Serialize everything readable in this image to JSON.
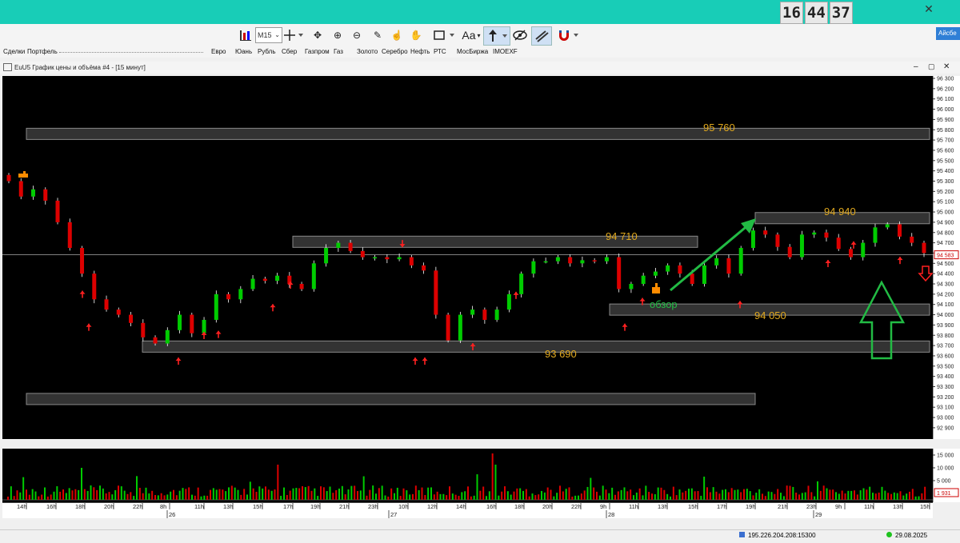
{
  "clock": {
    "h": "16",
    "m": "44",
    "s": "37"
  },
  "toolbar": {
    "timeframe": "M15",
    "text_tool": "Aa"
  },
  "tabs": [
    "Сделки",
    "Портфель"
  ],
  "instruments": [
    "Евро",
    "Юань",
    "Рубль",
    "Сбер",
    "Газпром",
    "Газ",
    "Золото",
    "Серебро",
    "Нефть",
    "РТС",
    "МосБиржа",
    "IMOEXF"
  ],
  "window": {
    "title": "EuU5 График цены и объёма #4 - [15 минут]"
  },
  "right_button": "Айсбе",
  "colors": {
    "up": "#00cc00",
    "down": "#dd0000",
    "level_text": "#e0a81e",
    "arrow_green": "#22bb44"
  },
  "chart_data": {
    "type": "candlestick",
    "price_axis": {
      "min": 92900,
      "max": 96300,
      "step": 100,
      "labels": [
        "96 300",
        "96 200",
        "96 100",
        "96 000",
        "95 900",
        "95 800",
        "95 700",
        "95 600",
        "95 500",
        "95 400",
        "95 300",
        "95 200",
        "95 100",
        "95 000",
        "94 900",
        "94 800",
        "94 700",
        "94 600",
        "94 500",
        "94 400",
        "94 300",
        "94 200",
        "94 100",
        "94 000",
        "93 900",
        "93 800",
        "93 700",
        "93 600",
        "93 500",
        "93 400",
        "93 300",
        "93 200",
        "93 100",
        "93 000",
        "92 900"
      ]
    },
    "current_price": "94 583",
    "levels": [
      {
        "label": "95 760",
        "price": 95760,
        "x_from": "25 13h",
        "x_to": "29 18h"
      },
      {
        "label": "94 710",
        "price": 94710,
        "x_from": "26 15h",
        "x_to": "28 15h"
      },
      {
        "label": "94 940",
        "price": 94940,
        "x_from": "28 19h",
        "x_to": "29 16h"
      },
      {
        "label": "94 050",
        "price": 94050,
        "x_from": "28 9h",
        "x_to": "29 18h"
      },
      {
        "label": "93 690",
        "price": 93690,
        "x_from": "25 21h",
        "x_to": "29 14h"
      },
      {
        "label": "",
        "price": 93180,
        "x_from": "25 13h",
        "x_to": "28 19h"
      }
    ],
    "annotation": "обзор",
    "volume_axis": {
      "labels": [
        "15 000",
        "10 000",
        "5 000"
      ],
      "current": "1 931"
    },
    "time_labels": [
      "14h",
      "16h",
      "18h",
      "20h",
      "22h",
      "8h",
      "11h",
      "13h",
      "15h",
      "17h",
      "19h",
      "21h",
      "23h",
      "10h",
      "12h",
      "14h",
      "16h",
      "18h",
      "20h",
      "22h",
      "9h",
      "11h",
      "13h",
      "15h",
      "17h",
      "19h",
      "21h",
      "23h",
      "9h",
      "11h",
      "13h",
      "15h"
    ],
    "date_labels": [
      "26",
      "27",
      "28",
      "29"
    ],
    "closes": [
      95300,
      95150,
      95220,
      95110,
      94900,
      94650,
      94400,
      94150,
      94050,
      94000,
      93920,
      93780,
      93720,
      93850,
      94000,
      93820,
      93950,
      94200,
      94150,
      94250,
      94350,
      94330,
      94380,
      94300,
      94250,
      94500,
      94650,
      94700,
      94620,
      94560,
      94560,
      94540,
      94560,
      94480,
      94430,
      94000,
      93750,
      94000,
      94050,
      93950,
      94050,
      94200,
      94400,
      94520,
      94520,
      94560,
      94500,
      94530,
      94520,
      94560,
      94250,
      94300,
      94380,
      94420,
      94480,
      94400,
      94300,
      94480,
      94550,
      94400,
      94650,
      94820,
      94780,
      94660,
      94560,
      94780,
      94800,
      94750,
      94640,
      94560,
      94700,
      94850,
      94880,
      94760,
      94700,
      94600
    ],
    "markers_up": [
      [
        100,
        94280
      ],
      [
        108,
        93960
      ],
      [
        220,
        93630
      ],
      [
        252,
        93880
      ],
      [
        270,
        93890
      ],
      [
        338,
        94150
      ],
      [
        360,
        94370
      ],
      [
        516,
        93630
      ],
      [
        528,
        93630
      ],
      [
        588,
        93770
      ],
      [
        642,
        94270
      ],
      [
        778,
        93960
      ],
      [
        800,
        94210
      ],
      [
        922,
        94180
      ],
      [
        1032,
        94580
      ],
      [
        1064,
        94760
      ],
      [
        1122,
        94610
      ]
    ],
    "markers_down": [
      [
        500,
        94610
      ]
    ]
  },
  "status": {
    "server": "195.226.204.208:15300",
    "date": "29.08.2025"
  }
}
